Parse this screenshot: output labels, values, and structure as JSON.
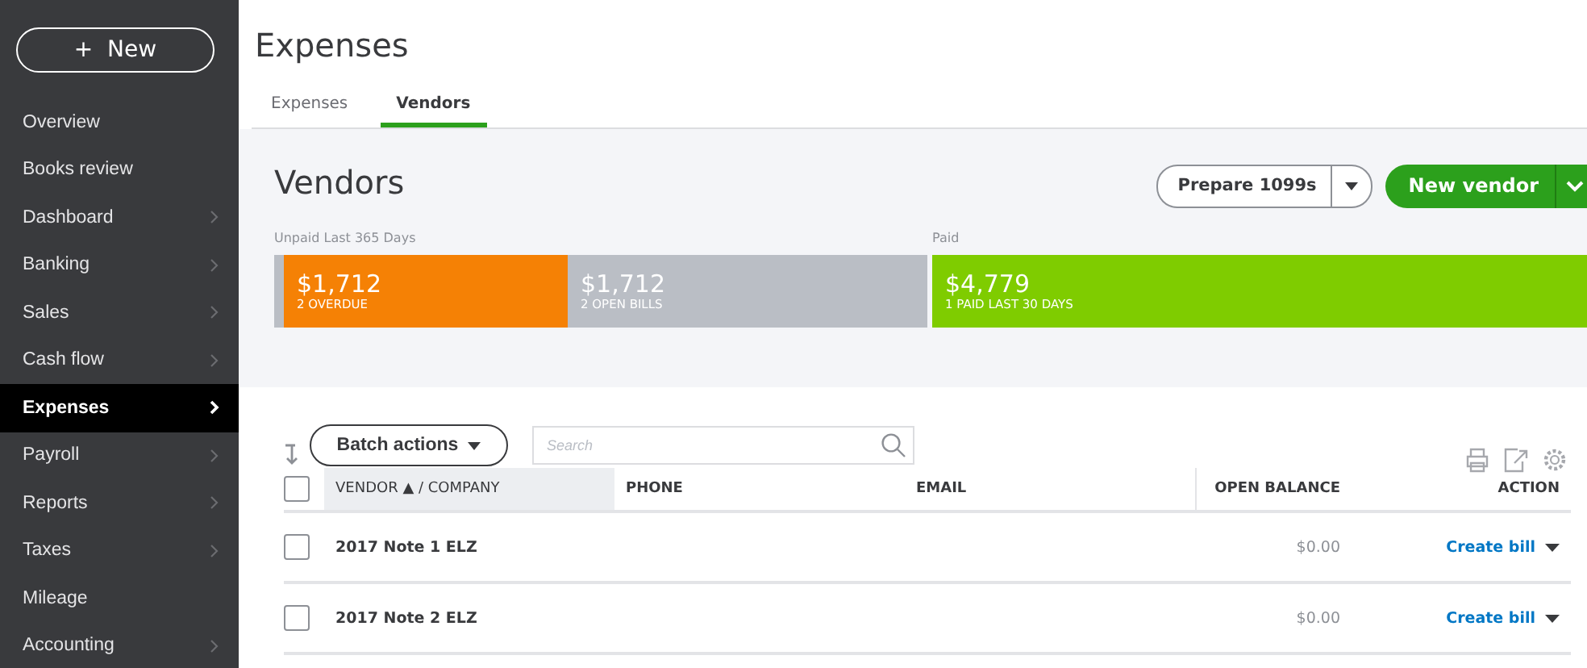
{
  "sidebar": {
    "new_button": {
      "icon": "+",
      "label": "New"
    },
    "items": [
      {
        "label": "Overview",
        "has_submenu": false,
        "selected": false
      },
      {
        "label": "Books review",
        "has_submenu": false,
        "selected": false
      },
      {
        "label": "Dashboard",
        "has_submenu": true,
        "selected": false
      },
      {
        "label": "Banking",
        "has_submenu": true,
        "selected": false
      },
      {
        "label": "Sales",
        "has_submenu": true,
        "selected": false
      },
      {
        "label": "Cash flow",
        "has_submenu": true,
        "selected": false
      },
      {
        "label": "Expenses",
        "has_submenu": true,
        "selected": true
      },
      {
        "label": "Payroll",
        "has_submenu": true,
        "selected": false
      },
      {
        "label": "Reports",
        "has_submenu": true,
        "selected": false
      },
      {
        "label": "Taxes",
        "has_submenu": true,
        "selected": false
      },
      {
        "label": "Mileage",
        "has_submenu": false,
        "selected": false
      },
      {
        "label": "Accounting",
        "has_submenu": true,
        "selected": false
      }
    ]
  },
  "page_title": "Expenses",
  "tabs": [
    {
      "label": "Expenses",
      "selected": false
    },
    {
      "label": "Vendors",
      "selected": true
    }
  ],
  "section_title": "Vendors",
  "prepare_button": "Prepare 1099s",
  "new_vendor_button": "New vendor",
  "unpaid": {
    "label": "Unpaid Last 365 Days",
    "segments": [
      {
        "amount": "$1,712",
        "caption": "2 OVERDUE",
        "color": "#f58105"
      },
      {
        "amount": "$1,712",
        "caption": "2 OPEN BILLS",
        "color": "#babec5"
      }
    ]
  },
  "paid": {
    "label": "Paid",
    "amount": "$4,779",
    "caption": "1 PAID LAST 30 DAYS",
    "color": "#7fcc00"
  },
  "batch_button": "Batch actions",
  "search": {
    "placeholder": "Search"
  },
  "table": {
    "select_all_checked": false,
    "columns": [
      "VENDOR ▲ / COMPANY",
      "PHONE",
      "EMAIL",
      "OPEN BALANCE",
      "ACTION"
    ],
    "rows": [
      {
        "vendor": "2017 Note 1 ELZ",
        "open_balance": "$0.00",
        "action": "Create bill",
        "checked": false
      },
      {
        "vendor": "2017 Note 2 ELZ",
        "open_balance": "$0.00",
        "action": "Create bill",
        "checked": false
      }
    ]
  }
}
